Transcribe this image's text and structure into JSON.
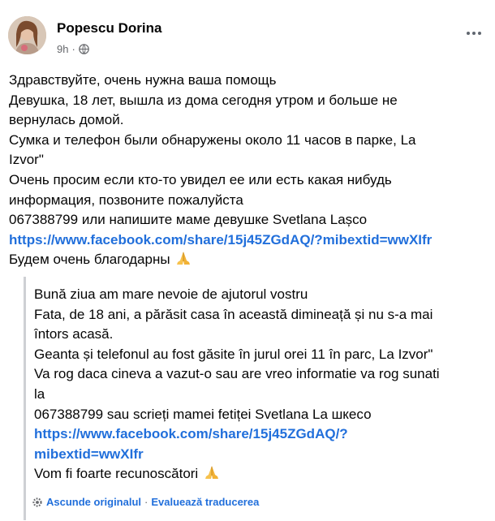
{
  "post": {
    "author": "Popescu Dorina",
    "time": "9h",
    "separator": "·",
    "body_lines": [
      "Здравствуйте, очень нужна ваша помощь",
      "Девушка, 18 лет, вышла из дома сегодня утром и больше не",
      "вернулась домой.",
      "Сумка и телефон были обнаружены около 11 часов в парке, La",
      "Izvor\"",
      "Очень просим если кто-то увидел ее или есть какая нибудь",
      "информация, позвоните пожалуйста",
      "067388799 или напишите маме девушке Svetlana Lașco"
    ],
    "link": "https://www.facebook.com/share/15j45ZGdAQ/?mibextid=wwXIfr",
    "closing": "Будем очень благодарны"
  },
  "translation": {
    "lines": [
      "Bună ziua am mare nevoie de ajutorul vostru",
      "Fata, de 18 ani, a părăsit casa în această dimineață și nu s-a mai",
      "întors acasă.",
      "Geanta și telefonul au fost găsite în jurul orei 11 în parc, La Izvor\"",
      "Va rog daca cineva a vazut-o sau are vreo informatie va rog sunati",
      "la",
      "067388799 sau scrieți mamei fetiței Svetlana La шкесо"
    ],
    "link_line1": "https://www.facebook.com/share/15j45ZGdAQ/?",
    "link_line2": "mibextid=wwXIfr",
    "closing": "Vom fi foarte recunoscători",
    "hide_original": "Ascunde originalul",
    "separator": "·",
    "rate_translation": "Evaluează traducerea"
  },
  "icons": {
    "avatar": "profile-photo",
    "privacy": "globe-icon",
    "menu": "more-options-icon",
    "emoji": "folded-hands-emoji",
    "translate": "gear-icon"
  },
  "colors": {
    "link": "#216fdb",
    "secondary_text": "#65676b",
    "quote_border": "#ced0d4"
  }
}
